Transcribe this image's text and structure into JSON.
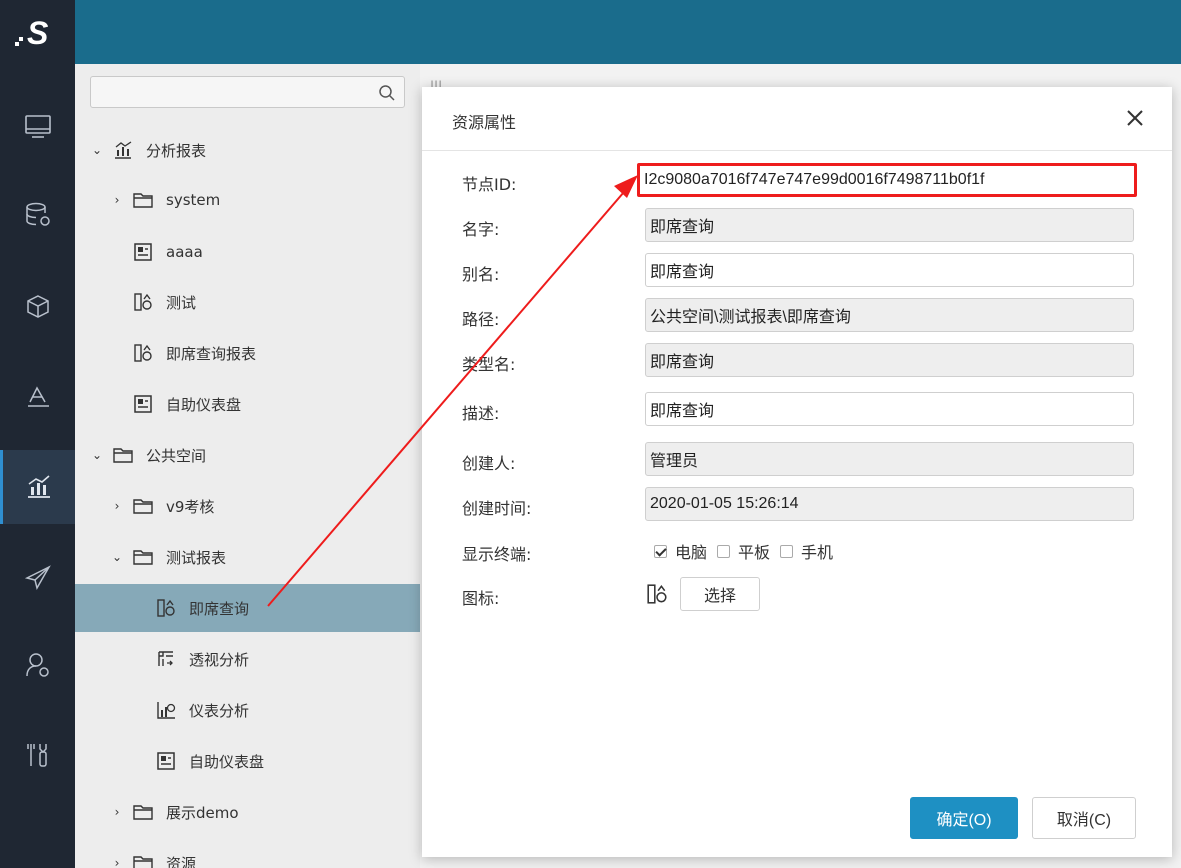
{
  "logo": {
    "text": "S"
  },
  "nav": {
    "items": [
      {
        "name": "monitor-icon"
      },
      {
        "name": "database-settings-icon"
      },
      {
        "name": "cube-icon"
      },
      {
        "name": "layers-icon"
      },
      {
        "name": "chart-icon",
        "active": true
      },
      {
        "name": "send-icon"
      },
      {
        "name": "user-settings-icon"
      },
      {
        "name": "tools-icon"
      }
    ]
  },
  "tree": {
    "search_placeholder": "",
    "items": [
      {
        "label": "分析报表",
        "chevron": "⌄",
        "icon": "chart-icon"
      },
      {
        "label": "system",
        "chevron": "›",
        "icon": "folder-icon"
      },
      {
        "label": "aaaa",
        "chevron": "",
        "icon": "dashboard-icon"
      },
      {
        "label": "测试",
        "chevron": "",
        "icon": "adhoc-query-icon"
      },
      {
        "label": "即席查询报表",
        "chevron": "",
        "icon": "adhoc-query-icon"
      },
      {
        "label": "自助仪表盘",
        "chevron": "",
        "icon": "dashboard-icon"
      },
      {
        "label": "公共空间",
        "chevron": "⌄",
        "icon": "folder-icon"
      },
      {
        "label": "v9考核",
        "chevron": "›",
        "icon": "folder-icon"
      },
      {
        "label": "测试报表",
        "chevron": "⌄",
        "icon": "folder-icon"
      },
      {
        "label": "即席查询",
        "chevron": "",
        "icon": "adhoc-query-icon",
        "selected": true
      },
      {
        "label": "透视分析",
        "chevron": "",
        "icon": "pivot-icon"
      },
      {
        "label": "仪表分析",
        "chevron": "",
        "icon": "gauge-chart-icon"
      },
      {
        "label": "自助仪表盘",
        "chevron": "",
        "icon": "dashboard-icon"
      },
      {
        "label": "展示demo",
        "chevron": "›",
        "icon": "folder-icon"
      },
      {
        "label": "资源",
        "chevron": "›",
        "icon": "folder-icon"
      }
    ]
  },
  "content": {
    "edge_text_1": "",
    "edge_text_2": ""
  },
  "dialog": {
    "title": "资源属性",
    "fields": {
      "node_id": {
        "label": "节点ID:",
        "value": "I2c9080a7016f747e747e99d0016f7498711b0f1f"
      },
      "name": {
        "label": "名字:",
        "value": "即席查询"
      },
      "alias": {
        "label": "别名:",
        "value": "即席查询"
      },
      "path": {
        "label": "路径:",
        "value": "公共空间\\测试报表\\即席查询"
      },
      "type_name": {
        "label": "类型名:",
        "value": "即席查询"
      },
      "description": {
        "label": "描述:",
        "value": "即席查询"
      },
      "creator": {
        "label": "创建人:",
        "value": "管理员"
      },
      "created_time": {
        "label": "创建时间:",
        "value": "2020-01-05 15:26:14"
      },
      "terminals": {
        "label": "显示终端:",
        "options": [
          {
            "label": "电脑",
            "checked": true
          },
          {
            "label": "平板",
            "checked": false
          },
          {
            "label": "手机",
            "checked": false
          }
        ]
      },
      "icon": {
        "label": "图标:",
        "choose_label": "选择"
      }
    },
    "ok_label": "确定(O)",
    "cancel_label": "取消(C)"
  },
  "colors": {
    "nav_bg": "#1f2733",
    "topbar_bg": "#1a6c8c",
    "selected_row": "#86a9b8",
    "primary_button": "#1e90c3",
    "highlight_annotation": "#ee1c1c"
  }
}
